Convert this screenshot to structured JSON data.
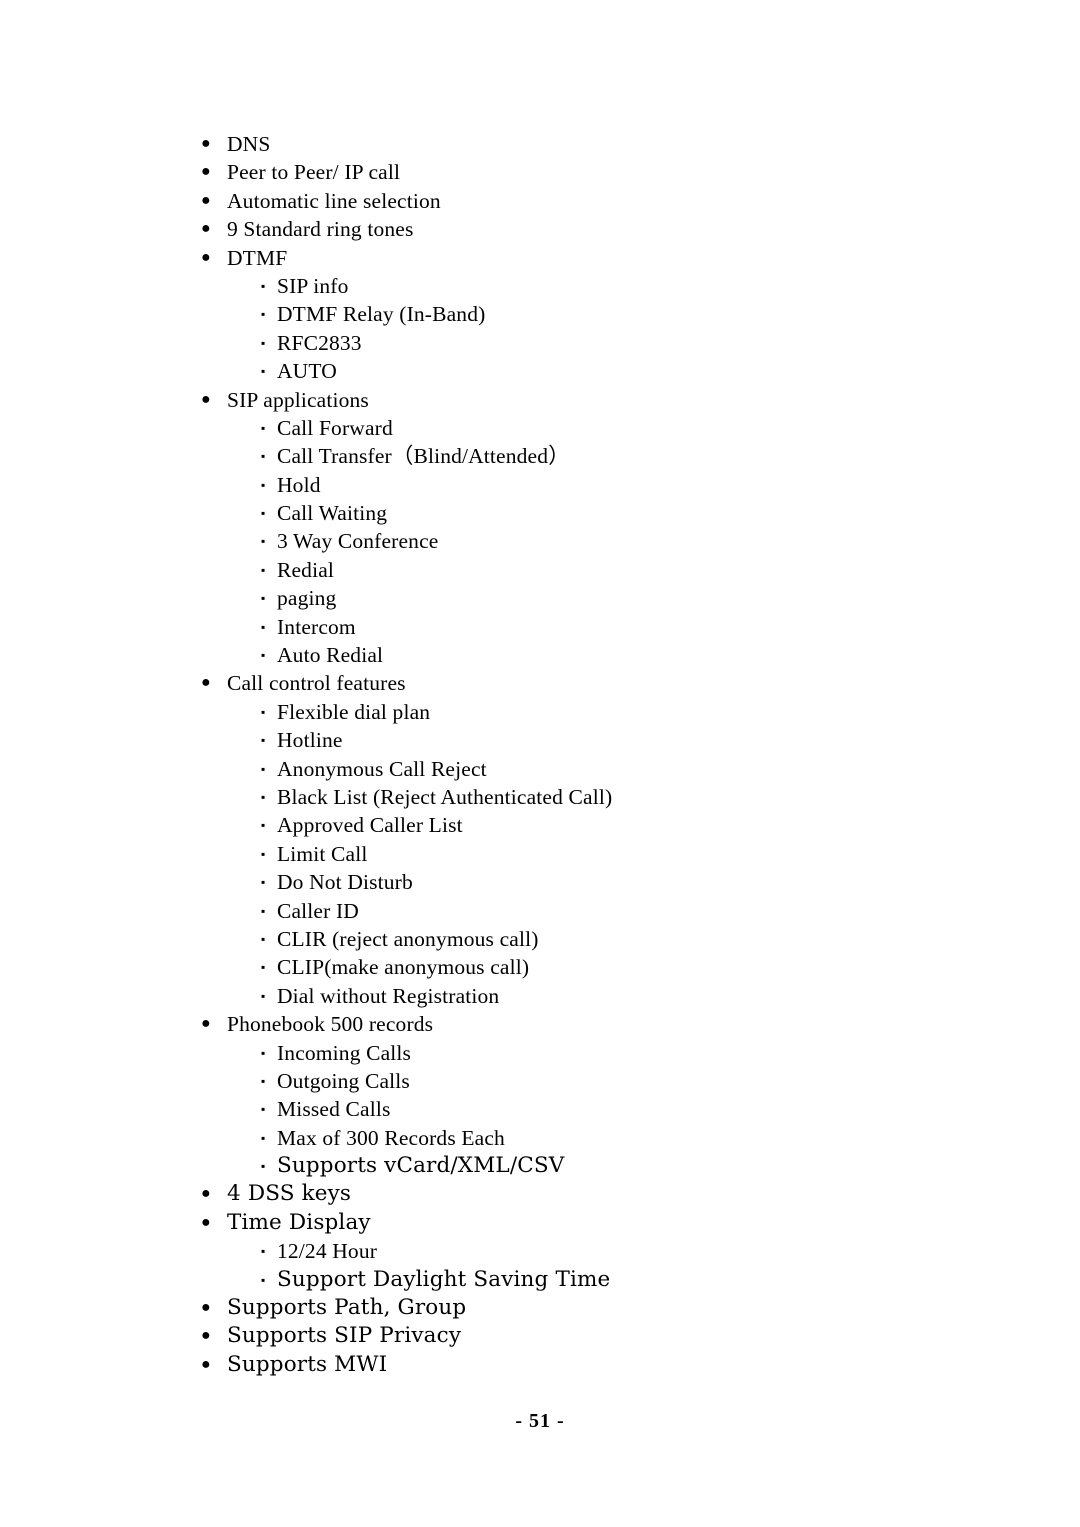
{
  "document": {
    "page_number_label": "- 51 -",
    "bullet_level1_glyph": "●",
    "bullet_level2_glyph": "▪",
    "text_color": "#000000",
    "background_color": "#ffffff"
  },
  "items": [
    {
      "level": 1,
      "label": "DNS"
    },
    {
      "level": 1,
      "label": "Peer to Peer/ IP call"
    },
    {
      "level": 1,
      "label": "Automatic line selection"
    },
    {
      "level": 1,
      "label": "9 Standard ring tones"
    },
    {
      "level": 1,
      "label": "DTMF"
    },
    {
      "level": 2,
      "label": "SIP info"
    },
    {
      "level": 2,
      "label": "DTMF Relay (In-Band)"
    },
    {
      "level": 2,
      "label": "RFC2833"
    },
    {
      "level": 2,
      "label": "AUTO"
    },
    {
      "level": 1,
      "label": "SIP applications"
    },
    {
      "level": 2,
      "label": "Call Forward"
    },
    {
      "level": 2,
      "label": "Call Transfer（Blind/Attended）"
    },
    {
      "level": 2,
      "label": "Hold"
    },
    {
      "level": 2,
      "label": "Call Waiting"
    },
    {
      "level": 2,
      "label": "3 Way Conference"
    },
    {
      "level": 2,
      "label": "Redial"
    },
    {
      "level": 2,
      "label": "paging"
    },
    {
      "level": 2,
      "label": "Intercom"
    },
    {
      "level": 2,
      "label": "Auto Redial"
    },
    {
      "level": 1,
      "label": "Call control features"
    },
    {
      "level": 2,
      "label": "Flexible dial plan"
    },
    {
      "level": 2,
      "label": "Hotline"
    },
    {
      "level": 2,
      "label": "Anonymous Call Reject"
    },
    {
      "level": 2,
      "label": "Black List (Reject Authenticated Call)"
    },
    {
      "level": 2,
      "label": "Approved Caller List"
    },
    {
      "level": 2,
      "label": "Limit Call"
    },
    {
      "level": 2,
      "label": "Do Not Disturb"
    },
    {
      "level": 2,
      "label": "Caller ID"
    },
    {
      "level": 2,
      "label": "CLIR (reject anonymous call)"
    },
    {
      "level": 2,
      "label": "CLIP(make anonymous call)"
    },
    {
      "level": 2,
      "label": "Dial without Registration"
    },
    {
      "level": 1,
      "label": "Phonebook 500 records"
    },
    {
      "level": 2,
      "label": "Incoming Calls"
    },
    {
      "level": 2,
      "label": "Outgoing Calls"
    },
    {
      "level": 2,
      "label": "Missed Calls"
    },
    {
      "level": 2,
      "label": "Max of 300 Records Each"
    },
    {
      "level": 2,
      "label": "Supports vCard/XML/CSV"
    },
    {
      "level": 1,
      "label": "4 DSS keys"
    },
    {
      "level": 1,
      "label": "Time Display"
    },
    {
      "level": 2,
      "label": "12/24 Hour"
    },
    {
      "level": 2,
      "label": "Support Daylight Saving Time"
    },
    {
      "level": 1,
      "label": "Supports Path, Group"
    },
    {
      "level": 1,
      "label": "Supports SIP Privacy"
    },
    {
      "level": 1,
      "label": "Supports MWI"
    }
  ]
}
